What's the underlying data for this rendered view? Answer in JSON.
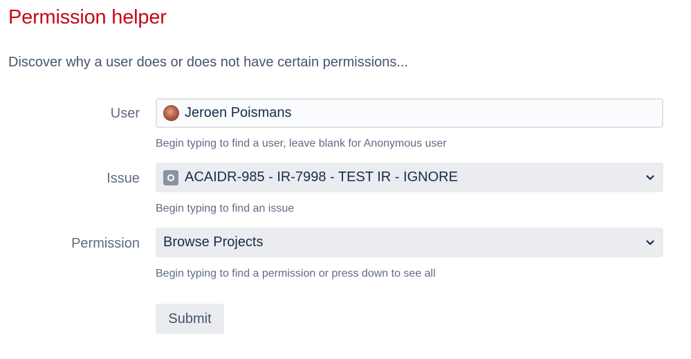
{
  "page": {
    "title": "Permission helper",
    "subtitle": "Discover why a user does or does not have certain permissions..."
  },
  "form": {
    "user": {
      "label": "User",
      "value": "Jeroen Poismans",
      "help": "Begin typing to find a user, leave blank for Anonymous user",
      "icon": "user-avatar"
    },
    "issue": {
      "label": "Issue",
      "value": "ACAIDR-985 - IR-7998 - TEST IR - IGNORE",
      "help": "Begin typing to find an issue",
      "icon": "issue-type-icon"
    },
    "permission": {
      "label": "Permission",
      "value": "Browse Projects",
      "help": "Begin typing to find a permission or press down to see all"
    },
    "submit_label": "Submit"
  },
  "colors": {
    "title": "#c4091a",
    "field_bg": "#ebecf0",
    "input_border": "#dfe1e6",
    "text": "#172b4d",
    "muted": "#5e6c84"
  }
}
